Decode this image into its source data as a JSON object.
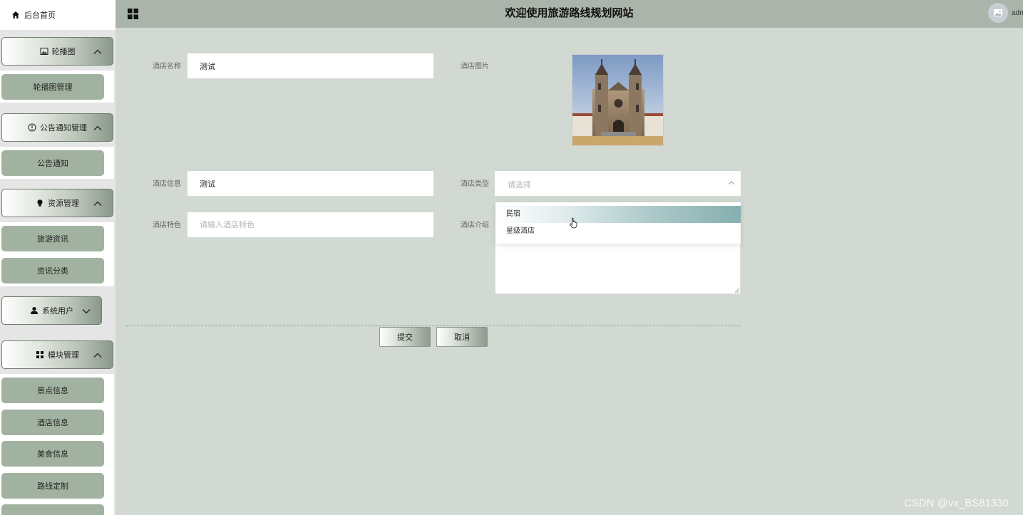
{
  "header": {
    "title": "欢迎使用旅游路线规划网站",
    "username": "adm"
  },
  "sidebar": {
    "home_label": "后台首页",
    "groups": [
      {
        "label": "轮播图",
        "icon": "image-icon",
        "expanded": true,
        "items": [
          "轮播图管理"
        ]
      },
      {
        "label": "公告通知管理",
        "icon": "info-icon",
        "expanded": true,
        "items": [
          "公告通知"
        ]
      },
      {
        "label": "资源管理",
        "icon": "bulb-icon",
        "expanded": true,
        "items": [
          "旅游资讯",
          "资讯分类"
        ]
      },
      {
        "label": "系统用户",
        "icon": "user-icon",
        "expanded": false,
        "items": []
      },
      {
        "label": "模块管理",
        "icon": "grid-icon",
        "expanded": true,
        "items": [
          "景点信息",
          "酒店信息",
          "美食信息",
          "路线定制"
        ]
      }
    ]
  },
  "form": {
    "name_label": "酒店名称",
    "name_value": "测试",
    "image_label": "酒店图片",
    "info_label": "酒店信息",
    "info_value": "测试",
    "type_label": "酒店类型",
    "type_placeholder": "请选择",
    "feature_label": "酒店特色",
    "feature_placeholder": "请输入酒店特色",
    "intro_label": "酒店介绍",
    "type_options": [
      "民宿",
      "星级酒店"
    ],
    "type_highlighted": "民宿",
    "submit_label": "提交",
    "cancel_label": "取消"
  },
  "watermark": "CSDN @vx_BS81330",
  "colors": {
    "background": "#d1d9d2",
    "topbar": "#aab4aa",
    "sub_item": "#a2b2a0",
    "dropdown_highlight": "#86afaf"
  }
}
